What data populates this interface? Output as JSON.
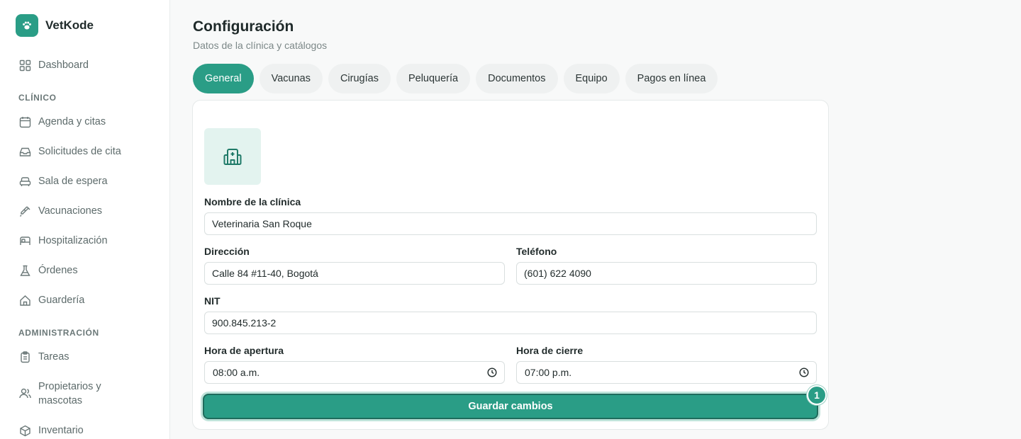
{
  "app": {
    "name": "VetKode"
  },
  "sidebar": {
    "dashboard": {
      "label": "Dashboard",
      "icon": "grid-icon"
    },
    "section_clinico": "CLÍNICO",
    "clinico": [
      {
        "label": "Agenda y citas",
        "icon": "calendar-icon"
      },
      {
        "label": "Solicitudes de cita",
        "icon": "inbox-icon"
      },
      {
        "label": "Sala de espera",
        "icon": "armchair-icon"
      },
      {
        "label": "Vacunaciones",
        "icon": "syringe-icon"
      },
      {
        "label": "Hospitalización",
        "icon": "bed-icon"
      },
      {
        "label": "Órdenes",
        "icon": "flask-icon"
      },
      {
        "label": "Guardería",
        "icon": "home-icon"
      }
    ],
    "section_admin": "ADMINISTRACIÓN",
    "admin": [
      {
        "label": "Tareas",
        "icon": "clipboard-icon"
      },
      {
        "label_line1": "Propietarios y",
        "label_line2": "mascotas",
        "icon": "users-icon"
      },
      {
        "label": "Inventario",
        "icon": "package-icon"
      }
    ]
  },
  "page": {
    "title": "Configuración",
    "subtitle": "Datos de la clínica y catálogos"
  },
  "tabs": [
    {
      "label": "General",
      "active": true
    },
    {
      "label": "Vacunas",
      "active": false
    },
    {
      "label": "Cirugías",
      "active": false
    },
    {
      "label": "Peluquería",
      "active": false
    },
    {
      "label": "Documentos",
      "active": false
    },
    {
      "label": "Equipo",
      "active": false
    },
    {
      "label": "Pagos en línea",
      "active": false
    }
  ],
  "form": {
    "clinic_icon": "hospital-icon",
    "name_label": "Nombre de la clínica",
    "name_value": "Veterinaria San Roque",
    "address_label": "Dirección",
    "address_value": "Calle 84 #11-40, Bogotá",
    "phone_label": "Teléfono",
    "phone_value": "(601) 622 4090",
    "nit_label": "NIT",
    "nit_value": "900.845.213-2",
    "open_label": "Hora de apertura",
    "open_value": "08:00 a.m.",
    "close_label": "Hora de cierre",
    "close_value": "07:00 p.m.",
    "save_label": "Guardar cambios",
    "badge_count": "1"
  },
  "colors": {
    "accent": "#2a9d86",
    "accent_light": "#e3f3ef",
    "tab_bg": "#eff1f1",
    "sidebar_text": "#5d6b6b"
  }
}
